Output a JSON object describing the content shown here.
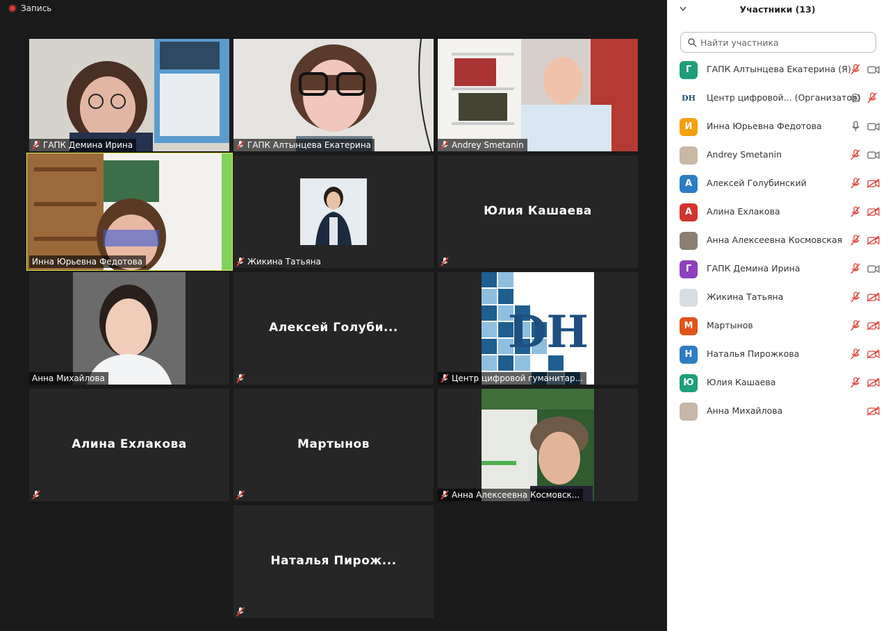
{
  "recording": {
    "label": "Запись"
  },
  "colors": {
    "accent_active": "#e5ef4e",
    "muted_red": "#e0413a",
    "sidebar_bg": "#ffffff"
  },
  "tiles": [
    {
      "name": "ГАПК Демина Ирина",
      "kind": "video",
      "muted": true
    },
    {
      "name": "ГАПК Алтынцева Екатерина",
      "kind": "video",
      "muted": true
    },
    {
      "name": "Andrey Smetanin",
      "kind": "video",
      "muted": true
    },
    {
      "name": "Инна Юрьевна Федотова",
      "kind": "video",
      "muted": false,
      "active": true
    },
    {
      "name": "Жикина Татьяна",
      "kind": "photo",
      "muted": true
    },
    {
      "name": "Юлия Кашаева",
      "kind": "name",
      "muted": true
    },
    {
      "name": "Анна Михайлова",
      "kind": "photo",
      "muted": false
    },
    {
      "name": "Алексей  Голуби...",
      "kind": "name",
      "muted": true
    },
    {
      "name": "Центр цифровой гуманитар...",
      "kind": "logo",
      "muted": true,
      "logo_text": "DH"
    },
    {
      "name": "Алина Ехлакова",
      "kind": "name",
      "muted": true
    },
    {
      "name": "Мартынов",
      "kind": "name",
      "muted": true
    },
    {
      "name": "Анна Алексеевна Космовск...",
      "kind": "photo",
      "muted": true
    },
    {
      "name": "Наталья  Пирож...",
      "kind": "name",
      "muted": true
    }
  ],
  "sidebar": {
    "title": "Участники (13)",
    "search_placeholder": "Найти участника",
    "participants": [
      {
        "name": "ГАПК Алтынцева Екатерина (Я)",
        "initial": "Г",
        "color": "#1e9e7a",
        "mic": "muted",
        "video": "on"
      },
      {
        "name": "Центр цифровой...  (Организатор)",
        "initial": "DH",
        "color": "#ffffff",
        "mic": "record",
        "video": "muted"
      },
      {
        "name": "Инна Юрьевна Федотова",
        "initial": "И",
        "color": "#f5a00f",
        "mic": "on",
        "video": "on"
      },
      {
        "name": "Andrey Smetanin",
        "initial": "",
        "color": "#c9b8a6",
        "mic": "muted",
        "video": "on"
      },
      {
        "name": "Алексей Голубинский",
        "initial": "А",
        "color": "#2d7dc4",
        "mic": "muted",
        "video": "off"
      },
      {
        "name": "Алина Ехлакова",
        "initial": "А",
        "color": "#d0362e",
        "mic": "muted",
        "video": "off"
      },
      {
        "name": "Анна Алексеевна Космовская",
        "initial": "",
        "color": "#8a7f72",
        "mic": "muted",
        "video": "off"
      },
      {
        "name": "ГАПК Демина Ирина",
        "initial": "Г",
        "color": "#8f3fbf",
        "mic": "muted",
        "video": "on"
      },
      {
        "name": "Жикина Татьяна",
        "initial": "",
        "color": "#d7dde3",
        "mic": "muted",
        "video": "off"
      },
      {
        "name": "Мартынов",
        "initial": "М",
        "color": "#e0531b",
        "mic": "muted",
        "video": "off"
      },
      {
        "name": "Наталья Пирожкова",
        "initial": "Н",
        "color": "#2d7dc4",
        "mic": "muted",
        "video": "off"
      },
      {
        "name": "Юлия Кашаева",
        "initial": "Ю",
        "color": "#1e9e7a",
        "mic": "muted",
        "video": "off"
      },
      {
        "name": "Анна Михайлова",
        "initial": "",
        "color": "#c7b7a8",
        "mic": "none",
        "video": "off"
      }
    ]
  }
}
